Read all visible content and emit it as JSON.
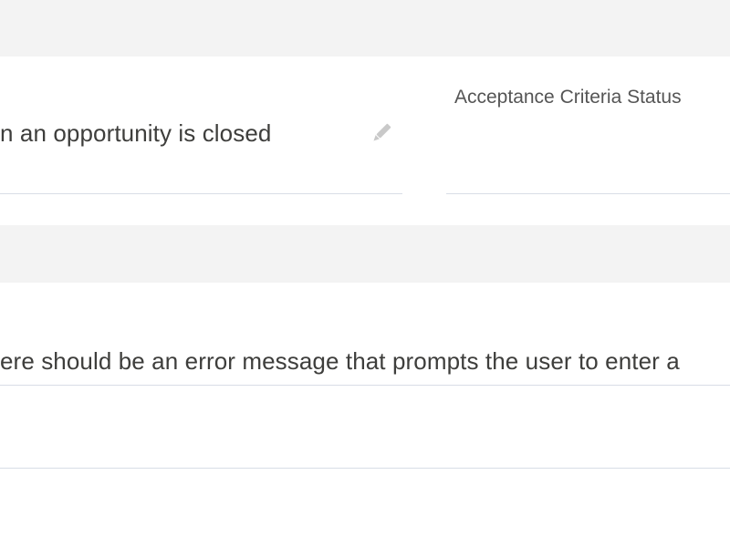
{
  "record": {
    "description_field": {
      "value": "n an opportunity is closed",
      "edit_icon": "pencil-icon"
    },
    "acceptance_criteria_status": {
      "label": "Acceptance Criteria Status",
      "value": ""
    },
    "acceptance_criteria_field": {
      "value": "ere should be an error message that prompts the user to enter a"
    }
  },
  "colors": {
    "section_band": "#f3f3f3",
    "text": "#3e3e3c",
    "label": "#555555",
    "divider": "#d8dde6",
    "icon": "#c9c9c9"
  }
}
